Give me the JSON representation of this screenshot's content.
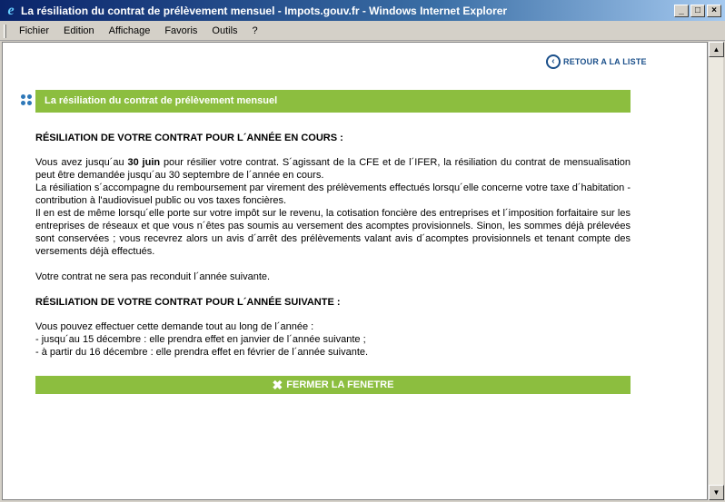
{
  "window": {
    "title": "La résiliation du contrat de prélèvement mensuel - Impots.gouv.fr - Windows Internet Explorer",
    "controls": [
      "_",
      "□",
      "×"
    ]
  },
  "menu": [
    "Fichier",
    "Edition",
    "Affichage",
    "Favoris",
    "Outils",
    "?"
  ],
  "page": {
    "back_link": "RETOUR A LA LISTE",
    "section_title": "La résiliation du contrat de prélèvement mensuel",
    "heading1": "RÉSILIATION DE VOTRE CONTRAT POUR L´ANNÉE EN COURS :",
    "p1_pre": "Vous avez jusqu´au ",
    "p1_bold": "30 juin",
    "p1_post": " pour résilier votre contrat. S´agissant de la CFE et de l´IFER, la résiliation du contrat de mensualisation peut être demandée jusqu´au 30 septembre de l´année en cours.",
    "p2": "La résiliation s´accompagne du remboursement par virement des prélèvements effectués lorsqu´elle concerne votre taxe d´habitation - contribution à l'audiovisuel public ou vos taxes foncières.",
    "p3": "Il en est de même lorsqu´elle porte sur votre impôt sur le revenu, la cotisation foncière des entreprises et l´imposition forfaitaire sur les entreprises de réseaux et que vous n´êtes pas soumis au versement des acomptes provisionnels. Sinon, les sommes déjà prélevées sont conservées ; vous recevrez alors un avis d´arrêt des prélèvements valant avis d´acomptes provisionnels et tenant compte des versements déjà effectués.",
    "p4": "Votre contrat ne sera pas reconduit l´année suivante.",
    "heading2": "RÉSILIATION DE VOTRE CONTRAT POUR L´ANNÉE SUIVANTE :",
    "p5": "Vous pouvez effectuer cette demande tout au long de l´année :",
    "p6": "- jusqu´au 15 décembre : elle prendra effet en janvier de l´année suivante ;",
    "p7": "- à partir du 16 décembre : elle prendra effet en février de l´année suivante.",
    "close_button": "FERMER LA FENETRE"
  },
  "colors": {
    "green": "#8cbe3f",
    "blue": "#1a4f8a",
    "titlebar": "#0a246a"
  }
}
